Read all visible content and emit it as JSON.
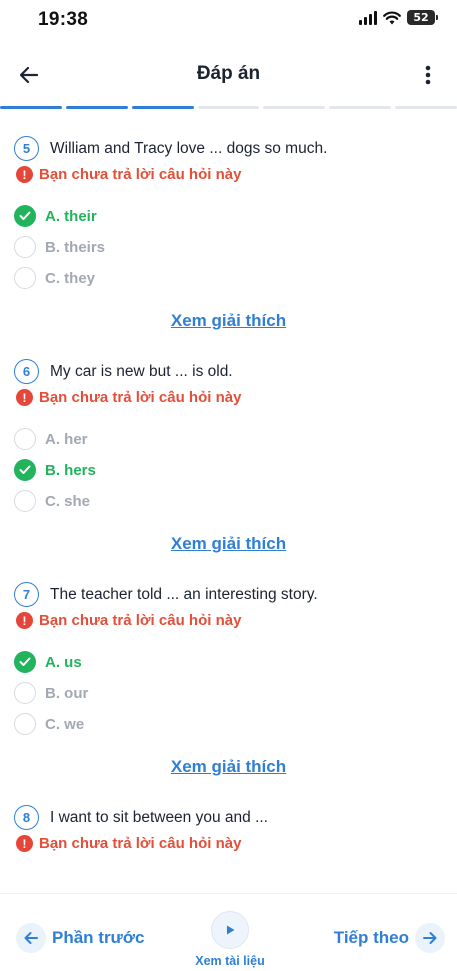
{
  "status_bar": {
    "time": "19:38",
    "battery": "52"
  },
  "header": {
    "title": "Đáp án"
  },
  "progress": {
    "total_segments": 7,
    "active_segments": [
      0,
      1,
      2
    ]
  },
  "warning_text": "Bạn chưa trả lời câu hỏi này",
  "explain_label": "Xem giải thích",
  "questions": [
    {
      "number": "5",
      "text": "William and Tracy love ... dogs so much.",
      "options": [
        {
          "label": "A. their",
          "correct": true
        },
        {
          "label": "B. theirs",
          "correct": false
        },
        {
          "label": "C. they",
          "correct": false
        }
      ]
    },
    {
      "number": "6",
      "text": "My car is new but ... is old.",
      "options": [
        {
          "label": "A. her",
          "correct": false
        },
        {
          "label": "B. hers",
          "correct": true
        },
        {
          "label": "C. she",
          "correct": false
        }
      ]
    },
    {
      "number": "7",
      "text": "The teacher told ... an interesting story.",
      "options": [
        {
          "label": "A. us",
          "correct": true
        },
        {
          "label": "B. our",
          "correct": false
        },
        {
          "label": "C. we",
          "correct": false
        }
      ]
    },
    {
      "number": "8",
      "text": "I want to sit between you and ...",
      "options": []
    }
  ],
  "bottom_nav": {
    "prev_label": "Phần trước",
    "center_label": "Xem tài liệu",
    "next_label": "Tiếp theo"
  },
  "colors": {
    "accent": "#2f7fd6",
    "correct": "#22b35d",
    "warning": "#e2503a",
    "inactive": "#a2a9b3"
  },
  "icons": {
    "back": "arrow-left-icon",
    "more": "more-vertical-icon",
    "warning": "exclamation-circle-icon",
    "check": "check-circle-icon",
    "play": "play-icon",
    "prev": "arrow-left-icon",
    "next": "arrow-right-icon"
  }
}
